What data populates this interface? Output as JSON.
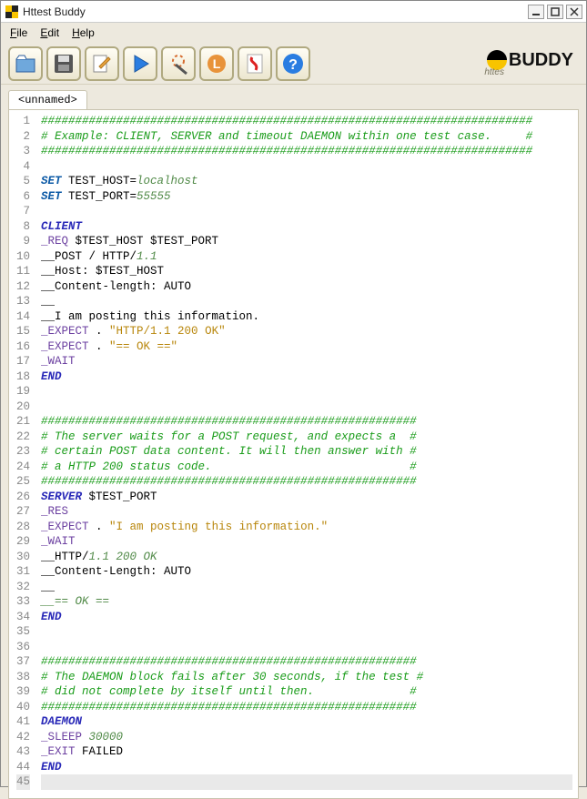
{
  "window": {
    "title": "Httest Buddy"
  },
  "menu": {
    "file": "File",
    "edit": "Edit",
    "help": "Help"
  },
  "toolbar": {
    "open": "Open",
    "save": "Save",
    "edit": "Edit",
    "run": "Run",
    "wizard": "Wizard",
    "library": "Library",
    "pdf": "PDF",
    "help": "Help"
  },
  "logo": {
    "sub": "httes",
    "main": "BUDDY"
  },
  "tab": {
    "label": "<unnamed>"
  },
  "code": {
    "lines": [
      [
        {
          "cls": "c-comment",
          "t": "########################################################################"
        }
      ],
      [
        {
          "cls": "c-comment",
          "t": "# Example: CLIENT, SERVER and timeout DAEMON within one test case.     #"
        }
      ],
      [
        {
          "cls": "c-comment",
          "t": "########################################################################"
        }
      ],
      [],
      [
        {
          "cls": "c-keyword",
          "t": "SET"
        },
        {
          "cls": "c-text",
          "t": " TEST_HOST="
        },
        {
          "cls": "c-number",
          "t": "localhost"
        }
      ],
      [
        {
          "cls": "c-keyword",
          "t": "SET"
        },
        {
          "cls": "c-text",
          "t": " TEST_PORT="
        },
        {
          "cls": "c-number",
          "t": "55555"
        }
      ],
      [],
      [
        {
          "cls": "c-section",
          "t": "CLIENT"
        }
      ],
      [
        {
          "cls": "c-directive",
          "t": "_REQ"
        },
        {
          "cls": "c-text",
          "t": " $TEST_HOST $TEST_PORT"
        }
      ],
      [
        {
          "cls": "c-text",
          "t": "__POST / HTTP/"
        },
        {
          "cls": "c-number",
          "t": "1.1"
        }
      ],
      [
        {
          "cls": "c-text",
          "t": "__Host: $TEST_HOST"
        }
      ],
      [
        {
          "cls": "c-text",
          "t": "__Content-length: AUTO"
        }
      ],
      [
        {
          "cls": "c-text",
          "t": "__"
        }
      ],
      [
        {
          "cls": "c-text",
          "t": "__I am posting this information."
        }
      ],
      [
        {
          "cls": "c-directive",
          "t": "_EXPECT"
        },
        {
          "cls": "c-text",
          "t": " . "
        },
        {
          "cls": "c-string",
          "t": "\"HTTP/1.1 200 OK\""
        }
      ],
      [
        {
          "cls": "c-directive",
          "t": "_EXPECT"
        },
        {
          "cls": "c-text",
          "t": " . "
        },
        {
          "cls": "c-string",
          "t": "\"== OK ==\""
        }
      ],
      [
        {
          "cls": "c-directive",
          "t": "_WAIT"
        }
      ],
      [
        {
          "cls": "c-end",
          "t": "END"
        }
      ],
      [],
      [],
      [
        {
          "cls": "c-comment",
          "t": "#######################################################"
        }
      ],
      [
        {
          "cls": "c-comment",
          "t": "# The server waits for a POST request, and expects a  #"
        }
      ],
      [
        {
          "cls": "c-comment",
          "t": "# certain POST data content. It will then answer with #"
        }
      ],
      [
        {
          "cls": "c-comment",
          "t": "# a HTTP 200 status code.                             #"
        }
      ],
      [
        {
          "cls": "c-comment",
          "t": "#######################################################"
        }
      ],
      [
        {
          "cls": "c-section",
          "t": "SERVER"
        },
        {
          "cls": "c-text",
          "t": " $TEST_PORT"
        }
      ],
      [
        {
          "cls": "c-directive",
          "t": "_RES"
        }
      ],
      [
        {
          "cls": "c-directive",
          "t": "_EXPECT"
        },
        {
          "cls": "c-text",
          "t": " . "
        },
        {
          "cls": "c-string",
          "t": "\"I am posting this information.\""
        }
      ],
      [
        {
          "cls": "c-directive",
          "t": "_WAIT"
        }
      ],
      [
        {
          "cls": "c-text",
          "t": "__HTTP/"
        },
        {
          "cls": "c-number",
          "t": "1.1 200 OK"
        }
      ],
      [
        {
          "cls": "c-text",
          "t": "__Content-Length: AUTO"
        }
      ],
      [
        {
          "cls": "c-text",
          "t": "__"
        }
      ],
      [
        {
          "cls": "c-number",
          "t": "__== OK =="
        }
      ],
      [
        {
          "cls": "c-end",
          "t": "END"
        }
      ],
      [],
      [],
      [
        {
          "cls": "c-comment",
          "t": "#######################################################"
        }
      ],
      [
        {
          "cls": "c-comment",
          "t": "# The DAEMON block fails after 30 seconds, if the test #"
        }
      ],
      [
        {
          "cls": "c-comment",
          "t": "# did not complete by itself until then.              #"
        }
      ],
      [
        {
          "cls": "c-comment",
          "t": "#######################################################"
        }
      ],
      [
        {
          "cls": "c-section",
          "t": "DAEMON"
        }
      ],
      [
        {
          "cls": "c-directive",
          "t": "_SLEEP"
        },
        {
          "cls": "c-text",
          "t": " "
        },
        {
          "cls": "c-number",
          "t": "30000"
        }
      ],
      [
        {
          "cls": "c-directive",
          "t": "_EXIT"
        },
        {
          "cls": "c-text",
          "t": " FAILED"
        }
      ],
      [
        {
          "cls": "c-end",
          "t": "END"
        }
      ],
      []
    ]
  }
}
